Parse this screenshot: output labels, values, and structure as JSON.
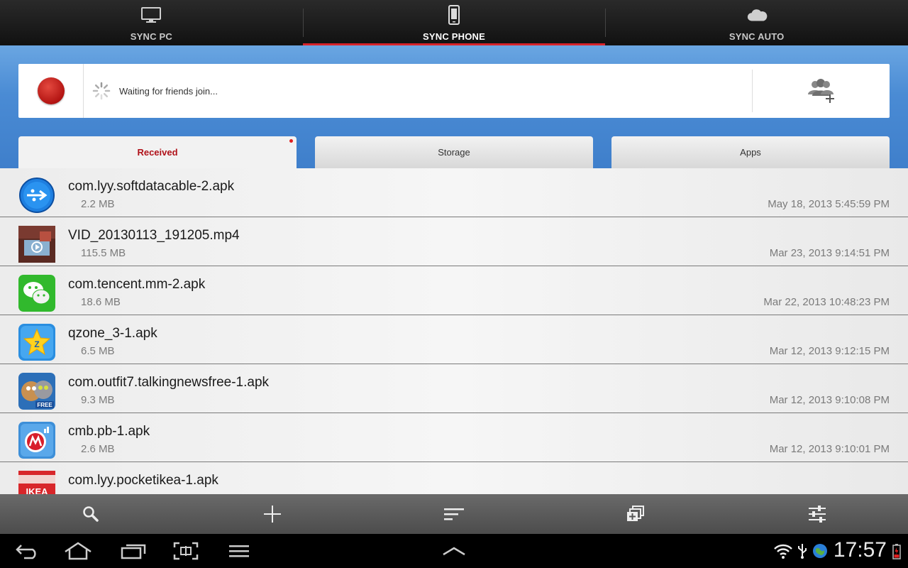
{
  "top_tabs": [
    {
      "label": "SYNC PC",
      "icon": "monitor-icon"
    },
    {
      "label": "SYNC PHONE",
      "icon": "phone-icon"
    },
    {
      "label": "SYNC AUTO",
      "icon": "cloud-icon"
    }
  ],
  "active_top_tab": 1,
  "status": {
    "text": "Waiting for friends join..."
  },
  "sub_tabs": [
    {
      "label": "Received"
    },
    {
      "label": "Storage"
    },
    {
      "label": "Apps"
    }
  ],
  "files": [
    {
      "name": "com.lyy.softdatacable-2.apk",
      "size": "2.2 MB",
      "date": "May 18, 2013 5:45:59 PM",
      "icon": "usb-app-icon"
    },
    {
      "name": "VID_20130113_191205.mp4",
      "size": "115.5 MB",
      "date": "Mar 23, 2013 9:14:51 PM",
      "icon": "video-thumbnail"
    },
    {
      "name": "com.tencent.mm-2.apk",
      "size": "18.6 MB",
      "date": "Mar 22, 2013 10:48:23 PM",
      "icon": "wechat-app-icon"
    },
    {
      "name": "qzone_3-1.apk",
      "size": "6.5 MB",
      "date": "Mar 12, 2013 9:12:15 PM",
      "icon": "qzone-app-icon"
    },
    {
      "name": "com.outfit7.talkingnewsfree-1.apk",
      "size": "9.3 MB",
      "date": "Mar 12, 2013 9:10:08 PM",
      "icon": "talking-news-app-icon"
    },
    {
      "name": "cmb.pb-1.apk",
      "size": "2.6 MB",
      "date": "Mar 12, 2013 9:10:01 PM",
      "icon": "cmb-app-icon"
    },
    {
      "name": "com.lyy.pocketikea-1.apk",
      "size": "",
      "date": "",
      "icon": "ikea-app-icon"
    }
  ],
  "toolbar": [
    "search-icon",
    "add-icon",
    "sort-icon",
    "multi-select-icon",
    "settings-sliders-icon"
  ],
  "system": {
    "clock": "17:57"
  },
  "colors": {
    "accent": "#d8232a",
    "band": "#4a8bd4"
  }
}
